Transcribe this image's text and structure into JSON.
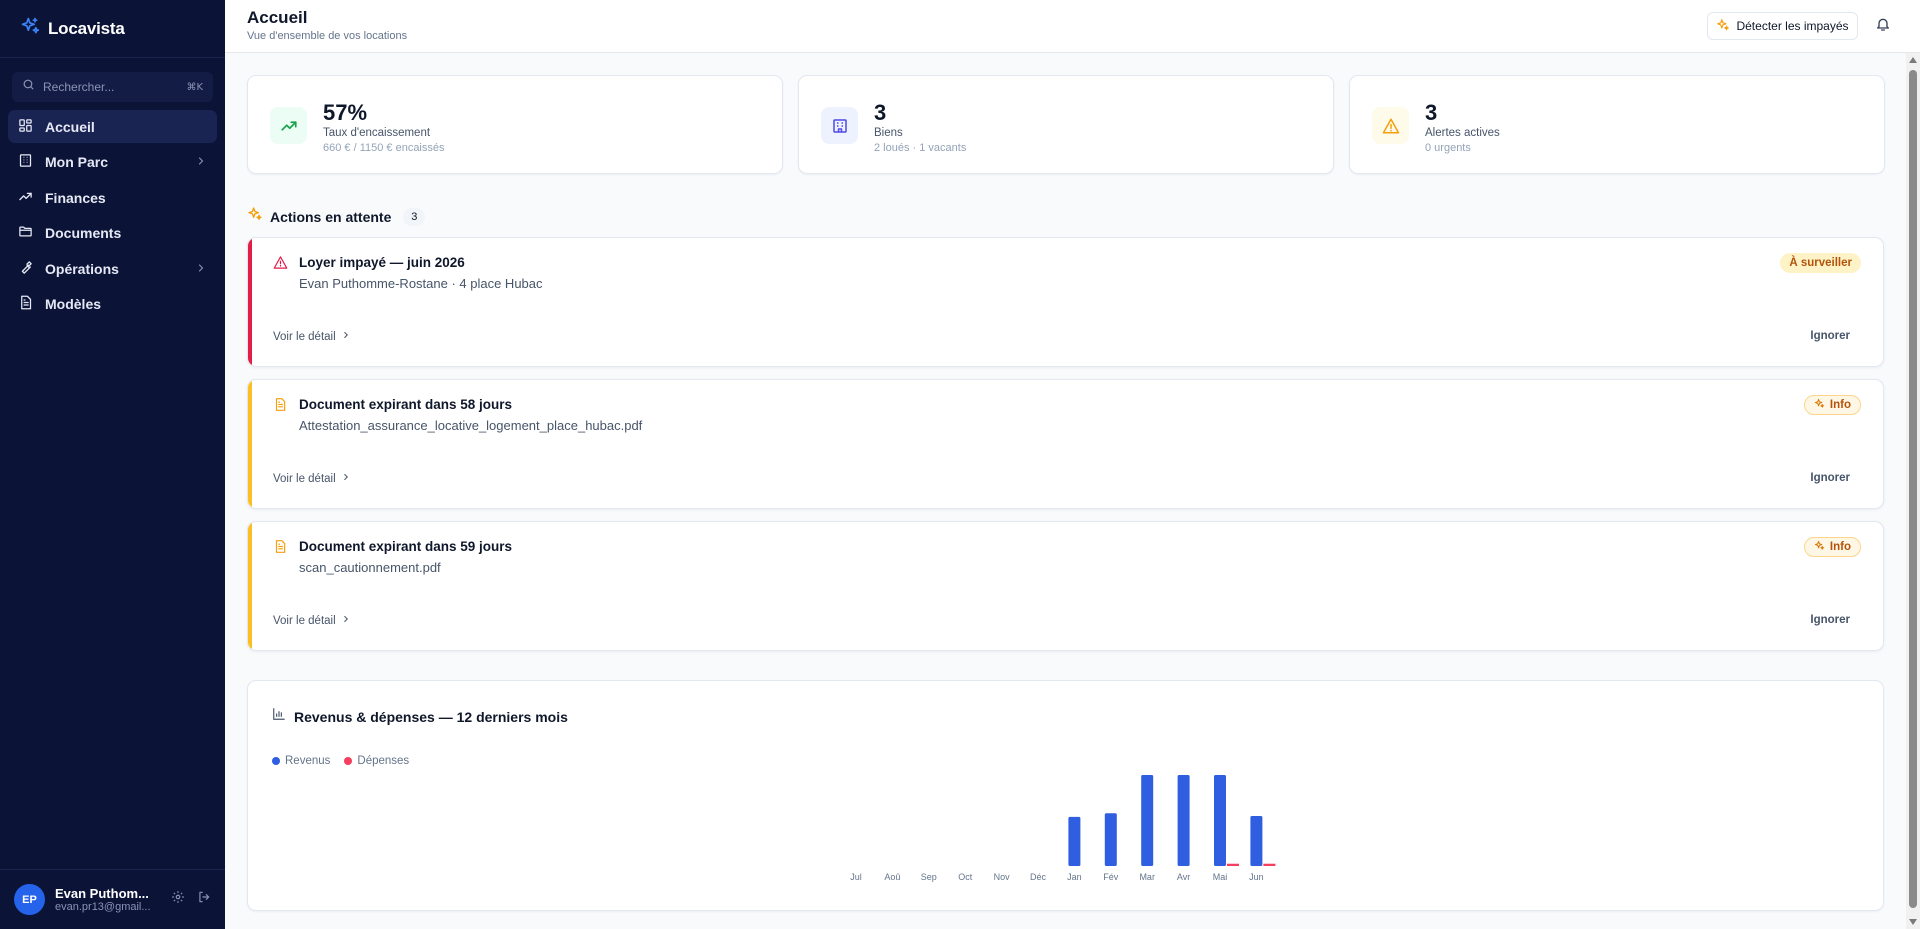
{
  "sidebar": {
    "brand": "Locavista",
    "search_placeholder": "Rechercher...",
    "search_shortcut": "⌘K",
    "items": [
      {
        "label": "Accueil"
      },
      {
        "label": "Mon Parc"
      },
      {
        "label": "Finances"
      },
      {
        "label": "Documents"
      },
      {
        "label": "Opérations"
      },
      {
        "label": "Modèles"
      }
    ],
    "user": {
      "initials": "EP",
      "name": "Evan Puthom...",
      "email": "evan.pr13@gmail..."
    }
  },
  "header": {
    "title": "Accueil",
    "subtitle": "Vue d'ensemble de vos locations",
    "detect_button": "Détecter les impayés"
  },
  "stats": [
    {
      "value": "57%",
      "label": "Taux d'encaissement",
      "detail": "660 € / 1150 € encaissés",
      "icon": "trending-up-icon",
      "color": "#16a34a"
    },
    {
      "value": "3",
      "label": "Biens",
      "detail": "2 loués · 1 vacants",
      "icon": "building-icon",
      "color": "#4f46e5"
    },
    {
      "value": "3",
      "label": "Alertes actives",
      "detail": "0 urgents",
      "icon": "alert-triangle-icon",
      "color": "#f59e0b"
    }
  ],
  "actions": {
    "title": "Actions en attente",
    "count": "3",
    "items": [
      {
        "title": "Loyer impayé — juin 2026",
        "subtitle": "Evan Puthomme-Rostane · 4 place Hubac",
        "badge": "À surveiller",
        "link": "Voir le détail",
        "ignore": "Ignorer",
        "accent": "#e11d48"
      },
      {
        "title": "Document expirant dans 58 jours",
        "subtitle": "Attestation_assurance_locative_logement_place_hubac.pdf",
        "badge": "Info",
        "link": "Voir le détail",
        "ignore": "Ignorer",
        "accent": "#fbbf24"
      },
      {
        "title": "Document expirant dans 59 jours",
        "subtitle": "scan_cautionnement.pdf",
        "badge": "Info",
        "link": "Voir le détail",
        "ignore": "Ignorer",
        "accent": "#fbbf24"
      }
    ]
  },
  "chart_data": {
    "type": "bar",
    "title": "Revenus & dépenses — 12 derniers mois",
    "categories": [
      "Jul",
      "Aoû",
      "Sep",
      "Oct",
      "Nov",
      "Déc",
      "Jan",
      "Fév",
      "Mar",
      "Avr",
      "Mai",
      "Jun"
    ],
    "series": [
      {
        "name": "Revenus",
        "color": "#2f5fe0",
        "values": [
          0,
          0,
          0,
          0,
          0,
          0,
          540,
          580,
          1000,
          1000,
          1000,
          550
        ]
      },
      {
        "name": "Dépenses",
        "color": "#f43f5e",
        "values": [
          0,
          0,
          0,
          0,
          0,
          0,
          0,
          0,
          0,
          0,
          25,
          25
        ]
      }
    ],
    "ylim": [
      0,
      1000
    ],
    "grid": false,
    "legend": "top-left"
  }
}
